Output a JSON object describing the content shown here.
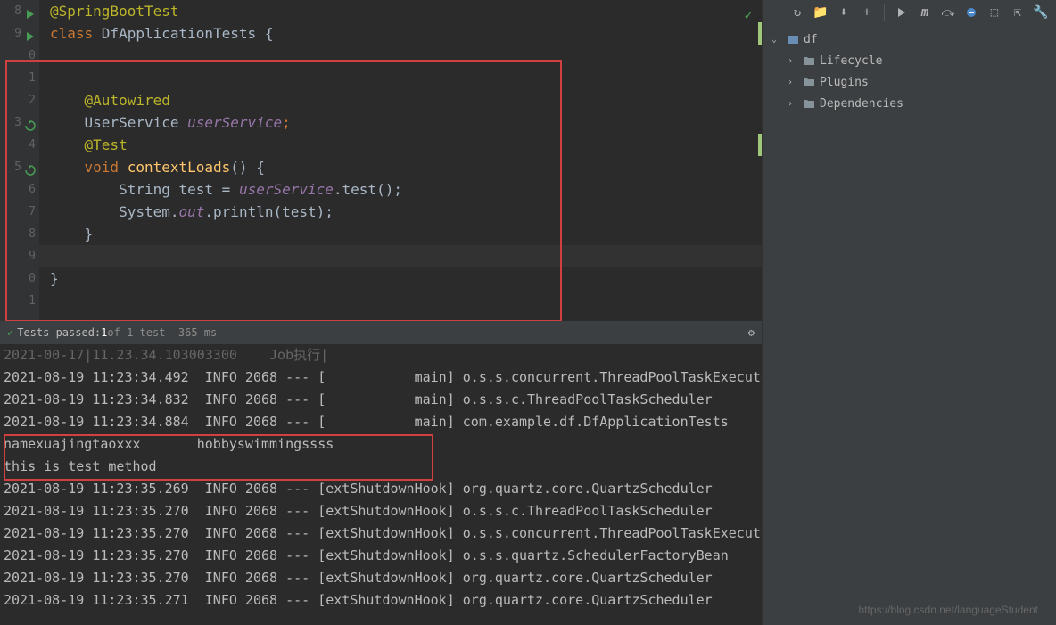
{
  "editor": {
    "lines": [
      {
        "num": "8",
        "indent": "",
        "tokens": [
          {
            "t": "@SpringBootTest",
            "c": "kw-annotation"
          }
        ],
        "icon": "run"
      },
      {
        "num": "9",
        "indent": "",
        "tokens": [
          {
            "t": "class ",
            "c": "kw-keyword"
          },
          {
            "t": "DfApplicationTests ",
            "c": "kw-class"
          },
          {
            "t": "{",
            "c": ""
          }
        ],
        "icon": "run"
      },
      {
        "num": "0",
        "indent": "",
        "tokens": []
      },
      {
        "num": "1",
        "indent": "",
        "tokens": []
      },
      {
        "num": "2",
        "indent": "    ",
        "tokens": [
          {
            "t": "@Autowired",
            "c": "kw-annotation"
          }
        ]
      },
      {
        "num": "3",
        "indent": "    ",
        "tokens": [
          {
            "t": "UserService ",
            "c": "kw-type"
          },
          {
            "t": "userService",
            "c": "kw-field"
          },
          {
            "t": ";",
            "c": "kw-semicolon"
          }
        ],
        "icon": "refresh"
      },
      {
        "num": "4",
        "indent": "    ",
        "tokens": [
          {
            "t": "@Test",
            "c": "kw-annotation"
          }
        ]
      },
      {
        "num": "5",
        "indent": "    ",
        "tokens": [
          {
            "t": "void ",
            "c": "kw-keyword"
          },
          {
            "t": "contextLoads",
            "c": "kw-method"
          },
          {
            "t": "() {",
            "c": ""
          }
        ],
        "icon": "refresh"
      },
      {
        "num": "6",
        "indent": "        ",
        "tokens": [
          {
            "t": "String ",
            "c": "kw-string-type"
          },
          {
            "t": "test = ",
            "c": ""
          },
          {
            "t": "userService",
            "c": "kw-field"
          },
          {
            "t": ".test();",
            "c": ""
          }
        ]
      },
      {
        "num": "7",
        "indent": "        ",
        "tokens": [
          {
            "t": "System.",
            "c": ""
          },
          {
            "t": "out",
            "c": "kw-static-field"
          },
          {
            "t": ".println(test);",
            "c": ""
          }
        ]
      },
      {
        "num": "8",
        "indent": "    ",
        "tokens": [
          {
            "t": "}",
            "c": ""
          }
        ]
      },
      {
        "num": "9",
        "indent": "",
        "tokens": [],
        "highlighted": true
      },
      {
        "num": "0",
        "indent": "",
        "tokens": [
          {
            "t": "}",
            "c": ""
          }
        ]
      },
      {
        "num": "1",
        "indent": "",
        "tokens": []
      }
    ],
    "change_markers": [
      1,
      6
    ]
  },
  "sidebar": {
    "root": {
      "label": "df",
      "expanded": true
    },
    "children": [
      {
        "label": "Lifecycle"
      },
      {
        "label": "Plugins"
      },
      {
        "label": "Dependencies"
      }
    ]
  },
  "toolbar": {
    "icons": [
      "refresh",
      "add-config",
      "download",
      "plus",
      "play",
      "m-icon",
      "skip",
      "offline",
      "show-deps",
      "collapse",
      "settings"
    ]
  },
  "test_status": {
    "prefix": "Tests passed: ",
    "passed": "1",
    "of_text": " of 1 test",
    "duration": " – 365 ms"
  },
  "console": {
    "lines": [
      "2021-00-17|11.23.34.103003300    Job执行|",
      "2021-08-19 11:23:34.492  INFO 2068 --- [           main] o.s.s.concurrent.ThreadPoolTaskExecutor  : Initializ",
      "2021-08-19 11:23:34.832  INFO 2068 --- [           main] o.s.s.c.ThreadPoolTaskScheduler          : Initializ",
      "2021-08-19 11:23:34.884  INFO 2068 --- [           main] com.example.df.DfApplicationTests        : Started D",
      "namexuajingtaoxxx       hobbyswimmingssss",
      "this is test method",
      "2021-08-19 11:23:35.269  INFO 2068 --- [extShutdownHook] org.quartz.core.QuartzScheduler          : Scheduler",
      "2021-08-19 11:23:35.270  INFO 2068 --- [extShutdownHook] o.s.s.c.ThreadPoolTaskScheduler          : Shutting ",
      "2021-08-19 11:23:35.270  INFO 2068 --- [extShutdownHook] o.s.s.concurrent.ThreadPoolTaskExecutor  : Shutting ",
      "2021-08-19 11:23:35.270  INFO 2068 --- [extShutdownHook] o.s.s.quartz.SchedulerFactoryBean        : Shutting ",
      "2021-08-19 11:23:35.270  INFO 2068 --- [extShutdownHook] org.quartz.core.QuartzScheduler          : Scheduler",
      "2021-08-19 11:23:35.271  INFO 2068 --- [extShutdownHook] org.quartz.core.QuartzScheduler          : Scheduler"
    ]
  },
  "watermark": "https://blog.csdn.net/languageStudent"
}
